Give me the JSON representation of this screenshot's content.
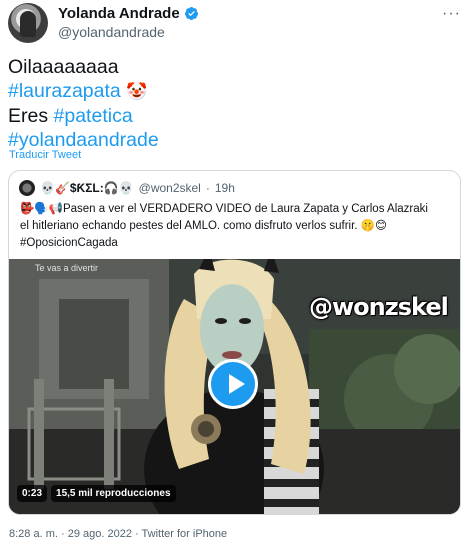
{
  "author": {
    "display_name": "Yolanda Andrade",
    "handle": "@yolandandrade"
  },
  "tweet": {
    "line1": "Oilaaaaaaaa",
    "hashtag1": "#laurazapata",
    "emoji1": "🤡",
    "line3_prefix": "Eres ",
    "hashtag2": "#patetica",
    "hashtag3": "#yolandaandrade"
  },
  "translate_label": "Traducir Tweet",
  "quote": {
    "name": "💀🎸$ƘΣL:🎧💀",
    "handle": "@won2skel",
    "separator": "·",
    "time": "19h",
    "text_line1": "👺🗣️📢Pasen a ver el VERDADERO VIDEO de Laura Zapata y Carlos Alazraki",
    "text_line2": "el hitleriano echando pestes del AMLO. como disfruto verlos sufrir. 🤫😊",
    "hashtag": "#OposicionCagada",
    "video": {
      "caption": "Te vas a divertir",
      "watermark": "@wonzskel",
      "duration": "0:23",
      "views": "15,5 mil reproducciones"
    }
  },
  "meta": {
    "time": "8:28 a. m.",
    "date": "29 ago. 2022",
    "source": "Twitter for iPhone",
    "sep": "·"
  },
  "colors": {
    "accent": "#1d9bf0",
    "text": "#0f1419",
    "muted": "#536471",
    "border": "#cfd9de"
  }
}
